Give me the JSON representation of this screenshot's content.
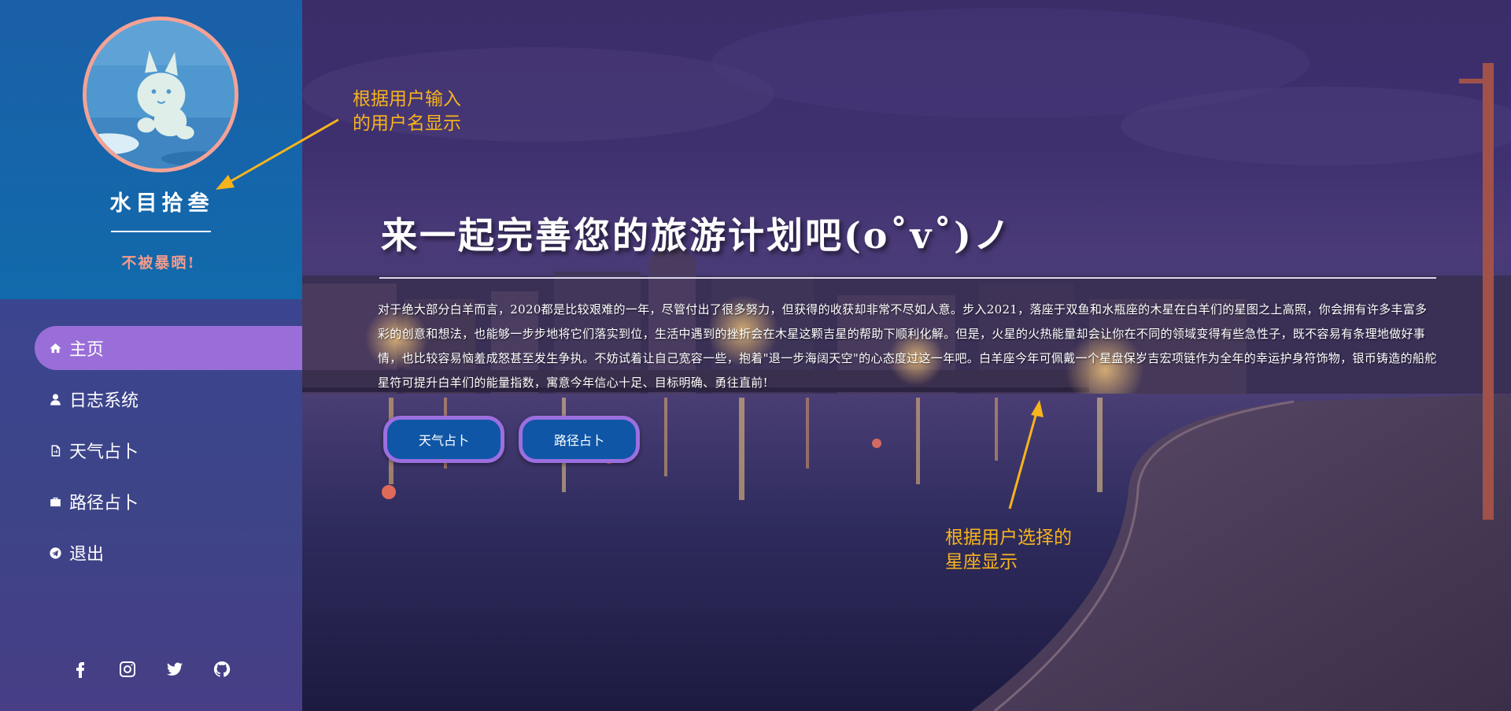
{
  "sidebar": {
    "username": "水目拾叁",
    "motto": "不被暴晒!",
    "nav": [
      {
        "label": "主页",
        "icon": "home-icon",
        "active": true
      },
      {
        "label": "日志系统",
        "icon": "user-icon",
        "active": false
      },
      {
        "label": "天气占卜",
        "icon": "file-icon",
        "active": false
      },
      {
        "label": "路径占卜",
        "icon": "briefcase-icon",
        "active": false
      },
      {
        "label": "退出",
        "icon": "telegram-icon",
        "active": false
      }
    ],
    "social": [
      "facebook-icon",
      "instagram-icon",
      "twitter-icon",
      "github-icon"
    ]
  },
  "main": {
    "heading": "来一起完善您的旅游计划吧(o˚v˚)ノ",
    "paragraph": "对于绝大部分白羊而言，2020都是比较艰难的一年，尽管付出了很多努力，但获得的收获却非常不尽如人意。步入2021，落座于双鱼和水瓶座的木星在白羊们的星图之上高照，你会拥有许多丰富多彩的创意和想法，也能够一步步地将它们落实到位，生活中遇到的挫折会在木星这颗吉星的帮助下顺利化解。但是，火星的火热能量却会让你在不同的领域变得有些急性子，既不容易有条理地做好事情，也比较容易恼羞成怒甚至发生争执。不妨试着让自己宽容一些，抱着\"退一步海阔天空\"的心态度过这一年吧。白羊座今年可佩戴一个星盘保岁吉宏项链作为全年的幸运护身符饰物，银币铸造的船舵星符可提升白羊们的能量指数，寓意今年信心十足、目标明确、勇往直前!",
    "buttons": {
      "weather": "天气占卜",
      "route": "路径占卜"
    }
  },
  "annotations": {
    "username_note_line1": "根据用户输入",
    "username_note_line2": "的用户名显示",
    "zodiac_note_line1": "根据用户选择的",
    "zodiac_note_line2": "星座显示"
  },
  "colors": {
    "profile_bg": "#116aab",
    "nav_active": "#9a6ed8",
    "motto": "#f29a8c",
    "button_bg": "#0f56a6",
    "button_border": "#9b6fe0",
    "annotation": "#f8b41c"
  }
}
